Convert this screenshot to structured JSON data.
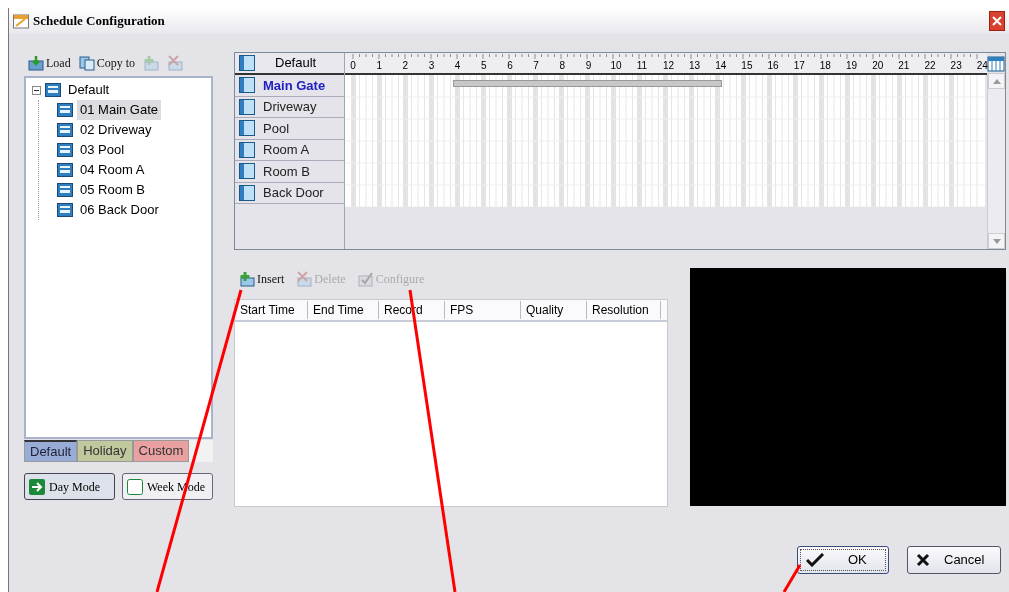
{
  "window": {
    "title": "Schedule Configuration"
  },
  "toolbar": [
    {
      "kind": "load",
      "label": "Load",
      "disabled": false
    },
    {
      "kind": "copy",
      "label": "Copy to",
      "disabled": false
    },
    {
      "kind": "add",
      "disabled": true
    },
    {
      "kind": "remove",
      "disabled": true
    }
  ],
  "tree": {
    "label": "Default",
    "expanded": true,
    "children": [
      {
        "label": "01 Main Gate",
        "selected": true
      },
      {
        "label": "02 Driveway",
        "selected": false
      },
      {
        "label": "03 Pool",
        "selected": false
      },
      {
        "label": "04 Room A",
        "selected": false
      },
      {
        "label": "05 Room B",
        "selected": false
      },
      {
        "label": "06 Back Door",
        "selected": false
      }
    ]
  },
  "tabs": [
    {
      "label": "Default",
      "selected": true,
      "color": "#98acd8"
    },
    {
      "label": "Holiday",
      "selected": false,
      "color": "#c0c89e"
    },
    {
      "label": "Custom",
      "selected": false,
      "color": "#e8a0a0"
    }
  ],
  "modes": [
    {
      "kind": "day",
      "label": "Day Mode",
      "selected": true
    },
    {
      "kind": "week",
      "label": "Week Mode",
      "selected": false
    }
  ],
  "schedule": {
    "header": "Default",
    "hours": [
      "0",
      "1",
      "2",
      "3",
      "4",
      "5",
      "6",
      "7",
      "8",
      "9",
      "10",
      "11",
      "12",
      "13",
      "14",
      "15",
      "16",
      "17",
      "18",
      "19",
      "20",
      "21",
      "22",
      "23",
      "24"
    ],
    "rows": [
      {
        "name": "Main Gate",
        "selected": true,
        "bar": {
          "offset": {
            "level": 0.16
          },
          "level": 0.431
        }
      },
      {
        "name": "Driveway",
        "selected": false
      },
      {
        "name": "Pool",
        "selected": false
      },
      {
        "name": "Room A",
        "selected": false
      },
      {
        "name": "Room B",
        "selected": false
      },
      {
        "name": "Back Door",
        "selected": false
      }
    ]
  },
  "actions": [
    {
      "kind": "insert",
      "label": "Insert",
      "disabled": false
    },
    {
      "kind": "delete",
      "label": "Delete",
      "disabled": true
    },
    {
      "kind": "configure",
      "label": "Configure",
      "disabled": true
    }
  ],
  "table": {
    "columns": [
      "Start Time",
      "End Time",
      "Record",
      "FPS",
      "Quality",
      "Resolution"
    ]
  },
  "preview": {
    "kind": "video"
  },
  "buttons": [
    {
      "kind": "ok",
      "label": "OK",
      "focused": true
    },
    {
      "kind": "cancel",
      "label": "Cancel",
      "focused": false
    }
  ]
}
